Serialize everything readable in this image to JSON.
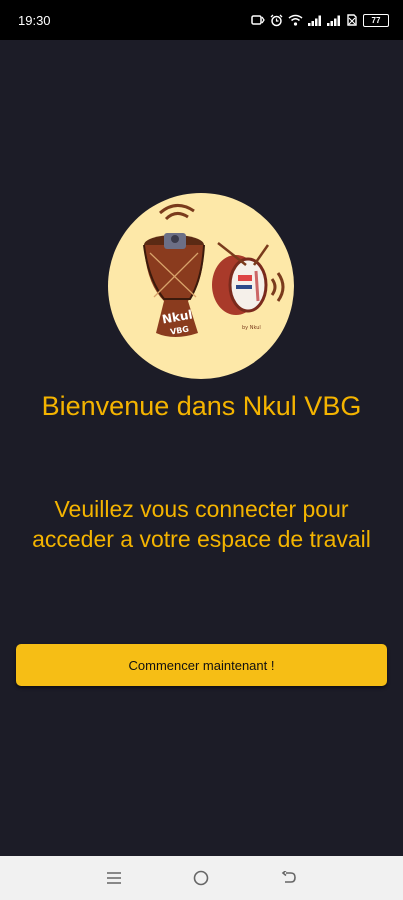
{
  "status_bar": {
    "time": "19:30",
    "battery": "77",
    "icons": [
      "nfc-icon",
      "alarm-icon",
      "wifi-icon",
      "signal-icon",
      "signal-icon",
      "sim-off-icon",
      "battery-icon"
    ]
  },
  "logo": {
    "drum_text": "Nkul VBG",
    "icon": "drum-logo"
  },
  "welcome_title": "Bienvenue dans Nkul VBG",
  "subtitle": {
    "line1": "Veuillez vous connecter pour",
    "line2": "acceder a votre espace de travail"
  },
  "start_button_label": "Commencer maintenant !",
  "nav_bar": {
    "icons": [
      "menu-icon",
      "home-icon",
      "back-icon"
    ]
  },
  "colors": {
    "background": "#1c1c27",
    "accent": "#f4b400",
    "button": "#f6be15",
    "logo_circle": "#fde8a8"
  }
}
